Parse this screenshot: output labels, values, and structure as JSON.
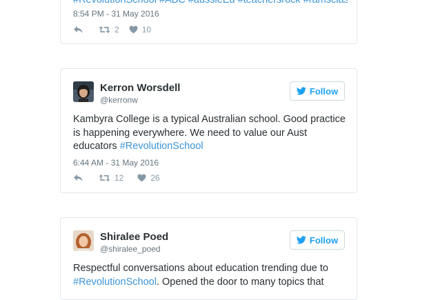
{
  "tweets": [
    {
      "hashtags_line": "#RevolutionSchool #ABC #aussieEd #teachersrock #ramsclass",
      "timestamp": "8:54 PM - 31 May 2016",
      "retweet_count": "2",
      "like_count": "10"
    },
    {
      "name": "Kerron Worsdell",
      "handle": "@kerronw",
      "follow_label": "Follow",
      "text_main": "Kambyra College is a typical Australian school. Good practice is happening everywhere. We need to value our Aust educators ",
      "hashtag": "#RevolutionSchool",
      "timestamp": "6:44 AM - 31 May 2016",
      "retweet_count": "12",
      "like_count": "26"
    },
    {
      "name": "Shiralee Poed",
      "handle": "@shiralee_poed",
      "follow_label": "Follow",
      "text_main": "Respectful conversations about education trending due to ",
      "hashtag": "#RevolutionSchool",
      "text_after": ". Opened the door to many topics that"
    }
  ],
  "colors": {
    "link": "#3b94d9",
    "follow": "#1da1f2",
    "meta": "#66757f",
    "action_icon": "#8899a6"
  }
}
